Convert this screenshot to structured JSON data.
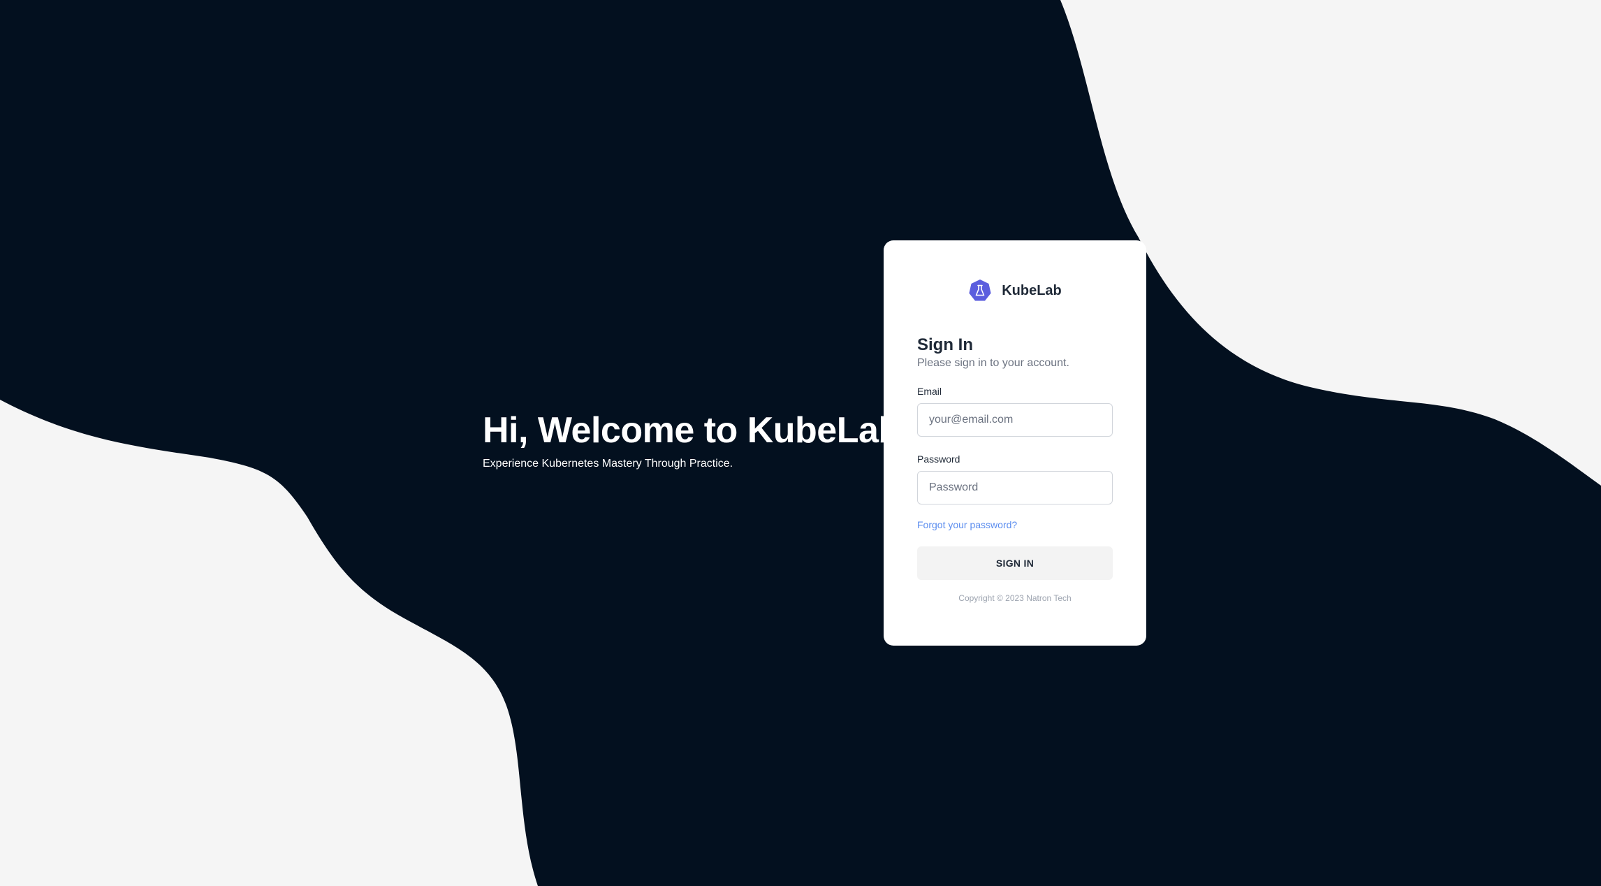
{
  "colors": {
    "dark_background": "#03101f",
    "light_background": "#f5f5f5",
    "accent": "#5b5ede",
    "link": "#5b8def"
  },
  "hero": {
    "title": "Hi, Welcome to KubeLab",
    "subtitle": "Experience Kubernetes Mastery Through Practice."
  },
  "brand": {
    "logo_icon": "kubernetes-flask-icon",
    "name": "KubeLab"
  },
  "form": {
    "title": "Sign In",
    "subtitle": "Please sign in to your account.",
    "email_label": "Email",
    "email_placeholder": "your@email.com",
    "email_value": "",
    "password_label": "Password",
    "password_placeholder": "Password",
    "password_value": "",
    "forgot_password": "Forgot your password?",
    "submit_label": "SIGN IN",
    "copyright": "Copyright © 2023 Natron Tech"
  }
}
